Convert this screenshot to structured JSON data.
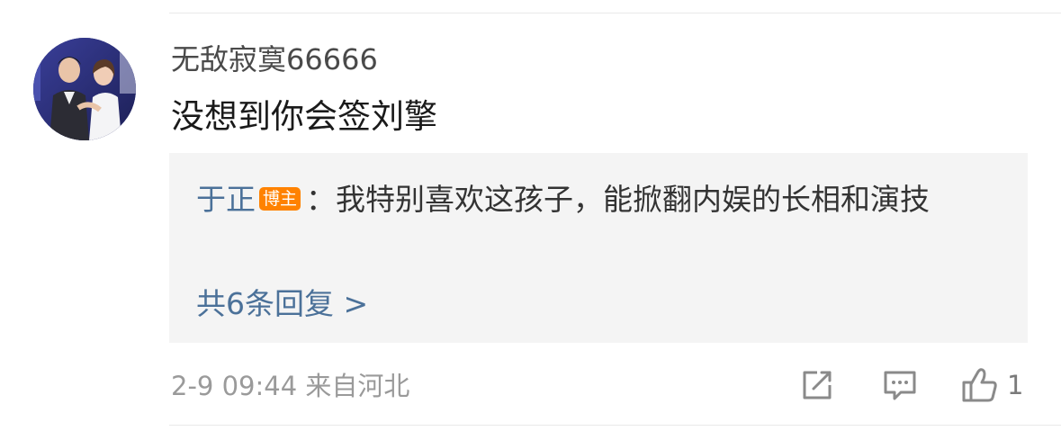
{
  "comment": {
    "username": "无敌寂寞66666",
    "text": "没想到你会签刘擎"
  },
  "reply": {
    "author": "于正",
    "badge": "博主",
    "separator": "：",
    "text": "我特别喜欢这孩子，能掀翻内娱的长相和演技",
    "more_label": "共6条回复 >"
  },
  "footer": {
    "meta": "2-9 09:44  来自河北",
    "like_count": "1"
  },
  "icons": {
    "repost": "repost-icon",
    "comment": "comment-icon",
    "like": "thumbs-up-icon"
  },
  "colors": {
    "link": "#4b7199",
    "badge": "#ff8200",
    "reply_bg": "#f4f4f4"
  }
}
